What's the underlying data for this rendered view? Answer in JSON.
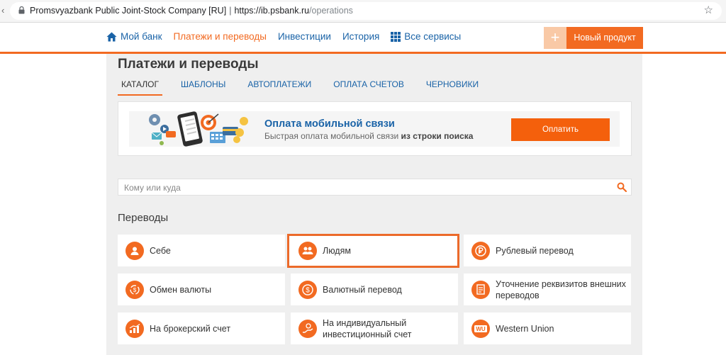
{
  "browser": {
    "url_host": "Promsvyazbank Public Joint-Stock Company [RU]",
    "url_separator": "|",
    "url_domain": "https://ib.psbank.ru",
    "url_path": "/operations"
  },
  "header": {
    "nav": [
      {
        "label": "Мой банк",
        "icon": "home-icon"
      },
      {
        "label": "Платежи и переводы",
        "active": true
      },
      {
        "label": "Инвестиции"
      },
      {
        "label": "История"
      },
      {
        "label": "Все сервисы",
        "icon": "grid-icon"
      }
    ],
    "new_product": {
      "plus": "+",
      "label": "Новый продукт"
    }
  },
  "page": {
    "title": "Платежи и переводы",
    "tabs": [
      "КАТАЛОГ",
      "ШАБЛОНЫ",
      "АВТОПЛАТЕЖИ",
      "ОПЛАТА СЧЕТОВ",
      "ЧЕРНОВИКИ"
    ],
    "active_tab": "КАТАЛОГ"
  },
  "banner": {
    "title": "Оплата мобильной связи",
    "subtitle": "Быстрая оплата мобильной связи",
    "subtitle_bold": "из строки поиска",
    "button": "Оплатить"
  },
  "search": {
    "placeholder": "Кому или куда",
    "value": ""
  },
  "transfers": {
    "title": "Переводы",
    "items": [
      {
        "label": "Себе",
        "icon": "person-icon"
      },
      {
        "label": "Людям",
        "icon": "people-icon",
        "selected": true
      },
      {
        "label": "Рублевый перевод",
        "icon": "ruble-icon"
      },
      {
        "label": "Обмен валюты",
        "icon": "currency-exchange-icon"
      },
      {
        "label": "Валютный перевод",
        "icon": "dollar-icon"
      },
      {
        "label": "Уточнение реквизитов внешних переводов",
        "icon": "document-icon"
      },
      {
        "label": "На брокерский счет",
        "icon": "chart-icon"
      },
      {
        "label": "На индивидуальный инвестиционный счет",
        "icon": "investment-icon"
      },
      {
        "label": "Western Union",
        "icon": "western-union-icon"
      }
    ]
  },
  "colors": {
    "accent": "#f26a21",
    "link": "#1a63a7",
    "background": "#efefef"
  }
}
